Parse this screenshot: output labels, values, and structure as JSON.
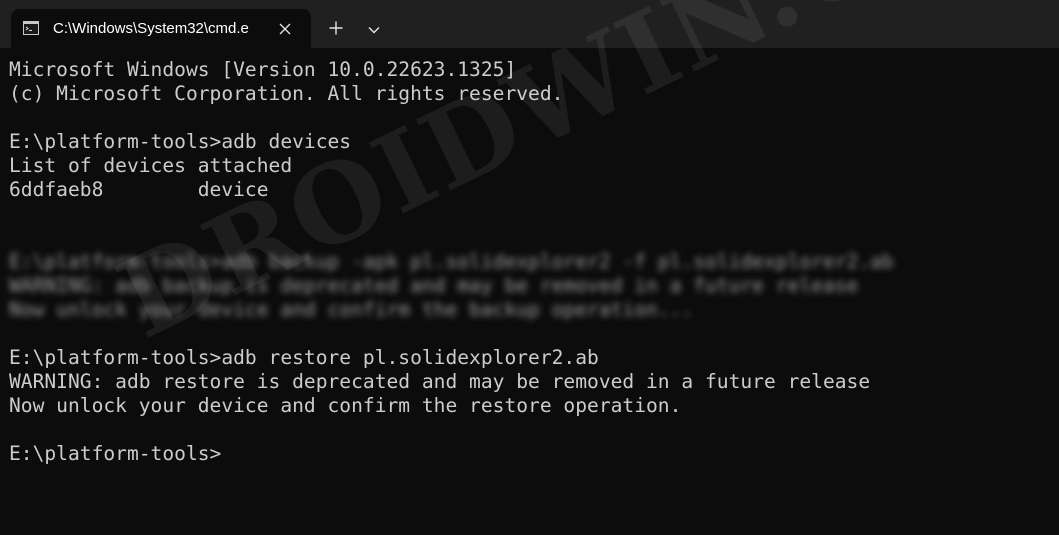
{
  "window": {
    "tab_title": "C:\\Windows\\System32\\cmd.e",
    "tab_icon": "terminal-icon",
    "close_icon": "close-icon",
    "new_tab_icon": "plus-icon",
    "dropdown_icon": "chevron-down-icon"
  },
  "console": {
    "lines": [
      "Microsoft Windows [Version 10.0.22623.1325]",
      "(c) Microsoft Corporation. All rights reserved.",
      "",
      "E:\\platform-tools>adb devices",
      "List of devices attached",
      "6ddfaeb8        device",
      "",
      "",
      "E:\\platform-tools>adb backup -apk pl.solidexplorer2 -f pl.solidexplorer2.ab",
      "WARNING: adb backup is deprecated and may be removed in a future release",
      "Now unlock your device and confirm the backup operation...",
      "",
      "E:\\platform-tools>adb restore pl.solidexplorer2.ab",
      "WARNING: adb restore is deprecated and may be removed in a future release",
      "Now unlock your device and confirm the restore operation.",
      "",
      "E:\\platform-tools>"
    ]
  },
  "watermark": "DROIDWIN.COM",
  "colors": {
    "background": "#0c0c0c",
    "titlebar": "#202020",
    "text": "#cccccc"
  }
}
